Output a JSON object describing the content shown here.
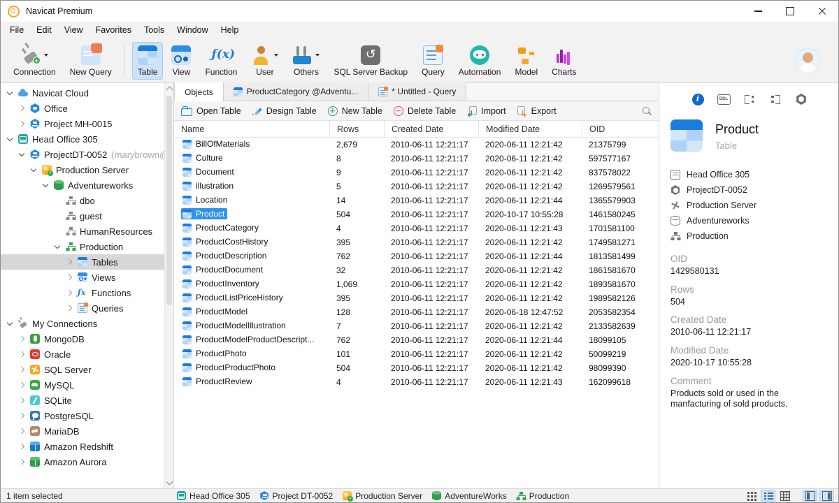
{
  "window": {
    "title": "Navicat Premium",
    "controls": [
      "minimize",
      "maximize",
      "close"
    ]
  },
  "menu": {
    "items": [
      "File",
      "Edit",
      "View",
      "Favorites",
      "Tools",
      "Window",
      "Help"
    ]
  },
  "toolbar": {
    "items": [
      {
        "label": "Connection",
        "icon": "connection",
        "caret": true,
        "badge": true
      },
      {
        "label": "New Query",
        "icon": "newquery"
      },
      {
        "type": "divider"
      },
      {
        "label": "Table",
        "icon": "table",
        "selected": true
      },
      {
        "label": "View",
        "icon": "view"
      },
      {
        "label": "Function",
        "icon": "fx"
      },
      {
        "label": "User",
        "icon": "user",
        "caret": true
      },
      {
        "label": "Others",
        "icon": "others",
        "caret": true
      },
      {
        "label": "SQL Server Backup",
        "icon": "backup"
      },
      {
        "label": "Query",
        "icon": "query"
      },
      {
        "label": "Automation",
        "icon": "automation"
      },
      {
        "label": "Model",
        "icon": "model"
      },
      {
        "label": "Charts",
        "icon": "charts"
      }
    ]
  },
  "sidebar": {
    "tree": [
      {
        "label": "Navicat Cloud",
        "icon": "cloud",
        "level": 0,
        "arrow": "expanded"
      },
      {
        "label": "Office",
        "icon": "office",
        "level": 1,
        "arrow": "collapsed"
      },
      {
        "label": "Project MH-0015",
        "icon": "project",
        "level": 1,
        "arrow": "collapsed"
      },
      {
        "label": "Head Office 305",
        "icon": "headoffice",
        "level": 0,
        "arrow": "expanded"
      },
      {
        "label": "ProjectDT-0052",
        "suffix": " (marybrown@",
        "icon": "project",
        "level": 1,
        "arrow": "expanded"
      },
      {
        "label": "Production Server",
        "icon": "server",
        "level": 2,
        "arrow": "expanded"
      },
      {
        "label": "Adventureworks",
        "icon": "database",
        "level": 3,
        "arrow": "expanded"
      },
      {
        "label": "dbo",
        "icon": "schema",
        "level": 4,
        "arrow": "none"
      },
      {
        "label": "guest",
        "icon": "schema",
        "level": 4,
        "arrow": "none"
      },
      {
        "label": "HumanResources",
        "icon": "schema",
        "level": 4,
        "arrow": "none"
      },
      {
        "label": "Production",
        "icon": "schema-green",
        "level": 4,
        "arrow": "expanded"
      },
      {
        "label": "Tables",
        "icon": "table",
        "level": 5,
        "arrow": "collapsed",
        "selected": true
      },
      {
        "label": "Views",
        "icon": "view",
        "level": 5,
        "arrow": "collapsed"
      },
      {
        "label": "Functions",
        "icon": "fx",
        "level": 5,
        "arrow": "collapsed"
      },
      {
        "label": "Queries",
        "icon": "query",
        "level": 5,
        "arrow": "collapsed"
      },
      {
        "label": "My Connections",
        "icon": "connection",
        "level": 0,
        "arrow": "expanded"
      },
      {
        "label": "MongoDB",
        "icon": "mongodb",
        "level": 1,
        "arrow": "collapsed"
      },
      {
        "label": "Oracle",
        "icon": "oracle",
        "level": 1,
        "arrow": "collapsed"
      },
      {
        "label": "SQL Server",
        "icon": "sqlserver",
        "level": 1,
        "arrow": "collapsed"
      },
      {
        "label": "MySQL",
        "icon": "mysql",
        "level": 1,
        "arrow": "collapsed"
      },
      {
        "label": "SQLite",
        "icon": "sqlite",
        "level": 1,
        "arrow": "collapsed"
      },
      {
        "label": "PostgreSQL",
        "icon": "postgres",
        "level": 1,
        "arrow": "collapsed"
      },
      {
        "label": "MariaDB",
        "icon": "mariadb",
        "level": 1,
        "arrow": "collapsed"
      },
      {
        "label": "Amazon Redshift",
        "icon": "cube-blue",
        "level": 1,
        "arrow": "collapsed"
      },
      {
        "label": "Amazon Aurora",
        "icon": "cube-green",
        "level": 1,
        "arrow": "collapsed"
      }
    ]
  },
  "tabs": [
    {
      "label": "Objects",
      "active": true
    },
    {
      "label": "ProductCategory @Adventu...",
      "icon": "table"
    },
    {
      "label": "* Untitled - Query",
      "icon": "query"
    }
  ],
  "object_toolbar": {
    "actions": [
      {
        "label": "Open Table",
        "icon": "folder"
      },
      {
        "label": "Design Table",
        "icon": "pencil"
      },
      {
        "label": "New Table",
        "icon": "plus"
      },
      {
        "label": "Delete Table",
        "icon": "minus"
      },
      {
        "label": "Import",
        "icon": "import"
      },
      {
        "label": "Export",
        "icon": "export"
      }
    ]
  },
  "table": {
    "columns": [
      "Name",
      "Rows",
      "Created Date",
      "Modified Date",
      "OID"
    ],
    "rows": [
      {
        "name": "BillOfMaterials",
        "rows": "2,679",
        "created": "2010-06-11 12:21:17",
        "modified": "2020-06-11 12:21:42",
        "oid": "21375799"
      },
      {
        "name": "Culture",
        "rows": "8",
        "created": "2010-06-11 12:21:17",
        "modified": "2020-06-11 12:21:42",
        "oid": "597577167"
      },
      {
        "name": "Document",
        "rows": "9",
        "created": "2010-06-11 12:21:17",
        "modified": "2020-06-11 12:21:42",
        "oid": "837578022"
      },
      {
        "name": "illustration",
        "rows": "5",
        "created": "2010-06-11 12:21:17",
        "modified": "2020-06-11 12:21:42",
        "oid": "1269579561"
      },
      {
        "name": "Location",
        "rows": "14",
        "created": "2010-06-11 12:21:17",
        "modified": "2020-06-11 12:21:44",
        "oid": "1365579903"
      },
      {
        "name": "Product",
        "rows": "504",
        "created": "2010-06-11 12:21:17",
        "modified": "2020-10-17 10:55:28",
        "oid": "1461580245",
        "selected": true
      },
      {
        "name": "ProductCategory",
        "rows": "4",
        "created": "2010-06-11 12:21:17",
        "modified": "2020-06-11 12:21:43",
        "oid": "1701581100"
      },
      {
        "name": "ProductCostHistory",
        "rows": "395",
        "created": "2010-06-11 12:21:17",
        "modified": "2020-06-11 12:21:42",
        "oid": "1749581271"
      },
      {
        "name": "ProductDescription",
        "rows": "762",
        "created": "2010-06-11 12:21:17",
        "modified": "2020-06-11 12:21:44",
        "oid": "1813581499"
      },
      {
        "name": "ProductDocument",
        "rows": "32",
        "created": "2010-06-11 12:21:17",
        "modified": "2020-06-11 12:21:42",
        "oid": "1861581670"
      },
      {
        "name": "ProductInventory",
        "rows": "1,069",
        "created": "2010-06-11 12:21:17",
        "modified": "2020-06-11 12:21:42",
        "oid": "1893581670"
      },
      {
        "name": "ProductListPriceHistory",
        "rows": "395",
        "created": "2010-06-11 12:21:17",
        "modified": "2020-06-11 12:21:42",
        "oid": "1989582126"
      },
      {
        "name": "ProductModel",
        "rows": "128",
        "created": "2010-06-11 12:21:17",
        "modified": "2020-06-18 12:47:52",
        "oid": "2053582354"
      },
      {
        "name": "ProductModelIllustration",
        "rows": "7",
        "created": "2010-06-11 12:21:17",
        "modified": "2020-06-11 12:21:42",
        "oid": "2133582639"
      },
      {
        "name": "ProductModelProductDescript...",
        "rows": "762",
        "created": "2010-06-11 12:21:17",
        "modified": "2020-06-11 12:21:44",
        "oid": "18099105"
      },
      {
        "name": "ProductPhoto",
        "rows": "101",
        "created": "2010-06-11 12:21:17",
        "modified": "2020-06-11 12:21:42",
        "oid": "50099219"
      },
      {
        "name": "ProductProductPhoto",
        "rows": "504",
        "created": "2010-06-11 12:21:17",
        "modified": "2020-06-11 12:21:42",
        "oid": "98099390"
      },
      {
        "name": "ProductReview",
        "rows": "4",
        "created": "2010-06-11 12:21:17",
        "modified": "2020-06-11 12:21:43",
        "oid": "162099618"
      }
    ]
  },
  "details": {
    "header_icons": [
      {
        "icon": "info",
        "active": true
      },
      {
        "icon": "ddl"
      },
      {
        "icon": "structout"
      },
      {
        "icon": "structin"
      },
      {
        "icon": "nut"
      }
    ],
    "title": "Product",
    "subtitle": "Table",
    "path": [
      {
        "icon": "card-gray",
        "label": "Head Office 305"
      },
      {
        "icon": "nut-gray",
        "label": "ProjectDT-0052"
      },
      {
        "icon": "server-gray",
        "label": "Production Server"
      },
      {
        "icon": "db-gray",
        "label": "Adventureworks"
      },
      {
        "icon": "schema-gray",
        "label": "Production"
      }
    ],
    "fields": [
      {
        "label": "OID",
        "value": "1429580131"
      },
      {
        "label": "Rows",
        "value": "504"
      },
      {
        "label": "Created Date",
        "value": "2010-06-11 12:21:17"
      },
      {
        "label": "Modified Date",
        "value": "2020-10-17 10:55:28"
      },
      {
        "label": "Comment",
        "value": "Products sold or used in the manfacturing of sold products."
      }
    ]
  },
  "status_bar": {
    "left": "1 item selected",
    "breadcrumbs": [
      {
        "icon": "headoffice",
        "label": "Head Office 305"
      },
      {
        "icon": "project",
        "label": "Project DT-0052"
      },
      {
        "icon": "server",
        "label": "Production Server"
      },
      {
        "icon": "database",
        "label": "AdventureWorks"
      },
      {
        "icon": "schema-green",
        "label": "Production"
      }
    ],
    "view_icons": [
      {
        "icon": "grid-view"
      },
      {
        "icon": "list-view",
        "selected": true
      },
      {
        "icon": "table-view"
      },
      {
        "type": "gap"
      },
      {
        "icon": "left-panel",
        "selected": true
      },
      {
        "icon": "right-panel",
        "selected": true
      }
    ]
  },
  "colors": {
    "accent": "#2e93ea",
    "toolbar_selected": "#cce3f8",
    "selection_blue": "#2e93ea",
    "tree_selected": "#d7d7d7"
  }
}
